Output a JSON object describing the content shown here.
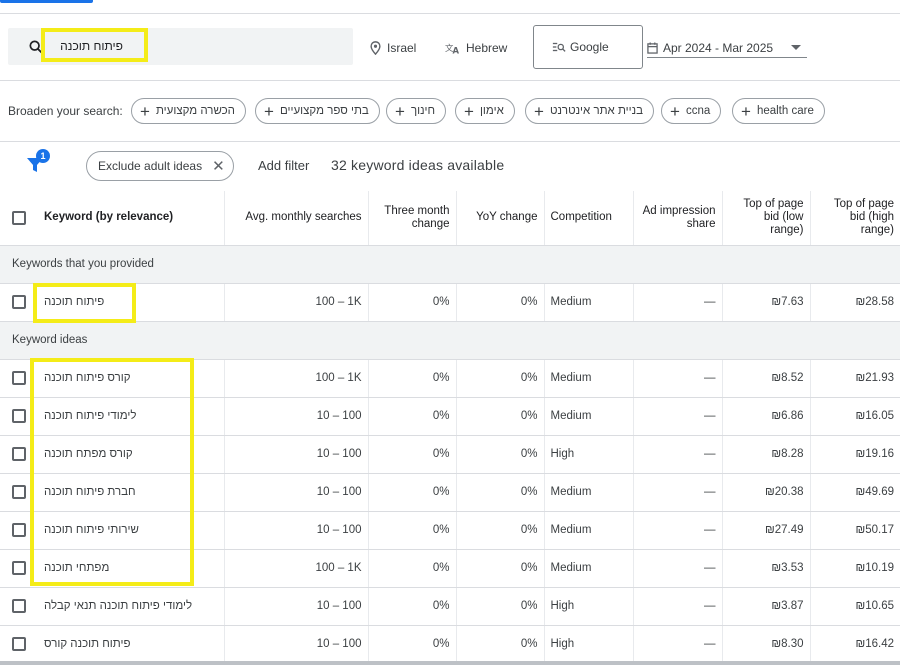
{
  "search": {
    "query": "פיתוח תוכנה",
    "location": "Israel",
    "language": "Hebrew",
    "network": "Google",
    "date_range": "Apr 2024 - Mar 2025"
  },
  "broaden": {
    "label": "Broaden your search:",
    "chips": [
      "הכשרה מקצועית",
      "בתי ספר מקצועיים",
      "חינוך",
      "אימון",
      "בניית אתר אינטרנט",
      "ccna",
      "health care"
    ]
  },
  "filters": {
    "badge_count": "1",
    "exclude_chip": "Exclude adult ideas",
    "add_filter": "Add filter",
    "ideas_count": "32 keyword ideas available"
  },
  "table": {
    "headers": {
      "keyword": "Keyword (by relevance)",
      "avg_searches": "Avg. monthly searches",
      "three_month": "Three month change",
      "yoy": "YoY change",
      "competition": "Competition",
      "ad_impression": "Ad impression share",
      "bid_low": "Top of page bid (low range)",
      "bid_high": "Top of page bid (high range)"
    },
    "section_provided": "Keywords that you provided",
    "section_ideas": "Keyword ideas",
    "provided": [
      {
        "keyword": "פיתוח תוכנה",
        "searches": "100 – 1K",
        "three_month": "0%",
        "yoy": "0%",
        "competition": "Medium",
        "impression": "—",
        "low": "₪7.63",
        "high": "₪28.58"
      }
    ],
    "ideas": [
      {
        "keyword": "קורס פיתוח תוכנה",
        "searches": "100 – 1K",
        "three_month": "0%",
        "yoy": "0%",
        "competition": "Medium",
        "impression": "—",
        "low": "₪8.52",
        "high": "₪21.93"
      },
      {
        "keyword": "לימודי פיתוח תוכנה",
        "searches": "10 – 100",
        "three_month": "0%",
        "yoy": "0%",
        "competition": "Medium",
        "impression": "—",
        "low": "₪6.86",
        "high": "₪16.05"
      },
      {
        "keyword": "קורס מפתח תוכנה",
        "searches": "10 – 100",
        "three_month": "0%",
        "yoy": "0%",
        "competition": "High",
        "impression": "—",
        "low": "₪8.28",
        "high": "₪19.16"
      },
      {
        "keyword": "חברת פיתוח תוכנה",
        "searches": "10 – 100",
        "three_month": "0%",
        "yoy": "0%",
        "competition": "Medium",
        "impression": "—",
        "low": "₪20.38",
        "high": "₪49.69"
      },
      {
        "keyword": "שירותי פיתוח תוכנה",
        "searches": "10 – 100",
        "three_month": "0%",
        "yoy": "0%",
        "competition": "Medium",
        "impression": "—",
        "low": "₪27.49",
        "high": "₪50.17"
      },
      {
        "keyword": "מפתחי תוכנה",
        "searches": "100 – 1K",
        "three_month": "0%",
        "yoy": "0%",
        "competition": "Medium",
        "impression": "—",
        "low": "₪3.53",
        "high": "₪10.19"
      },
      {
        "keyword": "לימודי פיתוח תוכנה תנאי קבלה",
        "searches": "10 – 100",
        "three_month": "0%",
        "yoy": "0%",
        "competition": "High",
        "impression": "—",
        "low": "₪3.87",
        "high": "₪10.65"
      },
      {
        "keyword": "פיתוח תוכנה קורס",
        "searches": "10 – 100",
        "three_month": "0%",
        "yoy": "0%",
        "competition": "High",
        "impression": "—",
        "low": "₪8.30",
        "high": "₪16.42"
      }
    ]
  },
  "colors": {
    "highlight": "#f4ec18",
    "accent": "#1a73e8"
  }
}
